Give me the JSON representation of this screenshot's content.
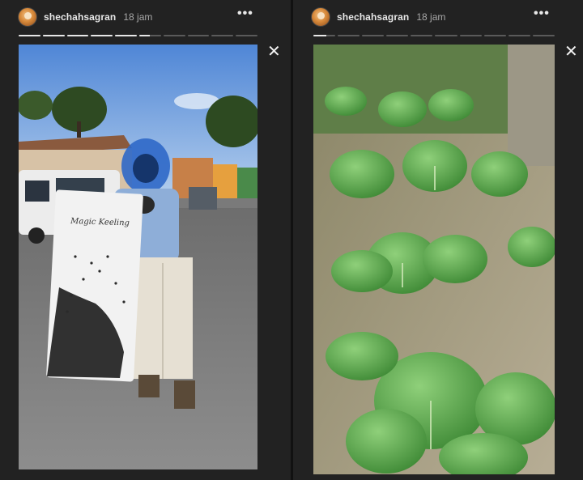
{
  "stories": [
    {
      "username": "shechahsagran",
      "time": "18 jam",
      "more_icon": "more-horizontal-icon",
      "close_icon": "close-icon",
      "progress": [
        1,
        1,
        1,
        1,
        1,
        0.5,
        0,
        0,
        0,
        0
      ],
      "photo_caption": "Magic Keeling"
    },
    {
      "username": "shechahsagran",
      "time": "18 jam",
      "more_icon": "more-horizontal-icon",
      "close_icon": "close-icon",
      "progress": [
        0.6,
        0,
        0,
        0,
        0,
        0,
        0,
        0,
        0,
        0
      ]
    }
  ],
  "colors": {
    "background": "#222222",
    "text": "#e8e8e8",
    "muted": "#a8a8a8",
    "progress_track": "#5a5a5a",
    "progress_fill": "#e6e6e6"
  }
}
